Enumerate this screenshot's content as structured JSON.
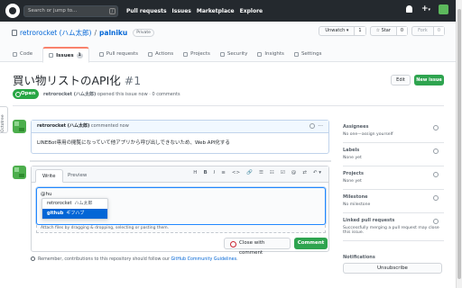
{
  "topbar": {
    "search_placeholder": "Search or jump to...",
    "slash_key": "/",
    "nav": [
      "Pull requests",
      "Issues",
      "Marketplace",
      "Explore"
    ],
    "plus": "+",
    "caret": "▾"
  },
  "repo": {
    "owner": "retrorocket (ハム太郎)",
    "separator": "/",
    "name": "palniku",
    "visibility": "Private",
    "watch_label": "Unwatch ▾",
    "watch_count": "1",
    "star_label": "☆ Star",
    "star_count": "0",
    "fork_label": "Fork",
    "fork_count": "0"
  },
  "tabs": [
    {
      "label": "Code"
    },
    {
      "label": "Issues",
      "count": "1"
    },
    {
      "label": "Pull requests"
    },
    {
      "label": "Actions"
    },
    {
      "label": "Projects"
    },
    {
      "label": "Security"
    },
    {
      "label": "Insights"
    },
    {
      "label": "Settings"
    }
  ],
  "sidetab": "Octotree",
  "issue": {
    "title": "買い物リストのAPI化",
    "number": "#1",
    "edit_label": "Edit",
    "new_issue_label": "New issue",
    "state": "Open",
    "author": "retrorocket (ハム太郎)",
    "opened_text": "opened this issue now · 0 comments"
  },
  "comment": {
    "author": "retrorocket (ハム太郎)",
    "time": "commented now",
    "more": "···",
    "body": "LINEBot専用の閲覧になっていて他アプリから呼び出しできないため、Web API化する"
  },
  "editor": {
    "write_tab": "Write",
    "preview_tab": "Preview",
    "toolbar": [
      "H",
      "B",
      "I",
      "≡",
      "<>",
      "🔗",
      "☰",
      "☷",
      "☑",
      "@",
      "⇄",
      "↶ ▾"
    ],
    "text": "@hu",
    "attach_hint": "Attach files by dragging & dropping, selecting or pasting them.",
    "suggestions": [
      {
        "login": "retrorocket",
        "name": "ハム太郎",
        "highlighted": false
      },
      {
        "login": "github",
        "name": "ギフハブ",
        "highlighted": true
      }
    ],
    "close_label": "Close with comment",
    "comment_label": "Comment"
  },
  "guide": {
    "text": "Remember, contributions to this repository should follow our",
    "link": "GitHub Community Guidelines",
    "end": "."
  },
  "sidebar": {
    "sections": [
      {
        "title": "Assignees",
        "value": "No one—assign yourself"
      },
      {
        "title": "Labels",
        "value": "None yet"
      },
      {
        "title": "Projects",
        "value": "None yet"
      },
      {
        "title": "Milestone",
        "value": "No milestone"
      },
      {
        "title": "Linked pull requests",
        "value": "Successfully merging a pull request may close this issue."
      }
    ],
    "notifications_title": "Notifications",
    "subscribe_label": "Unsubscribe"
  },
  "colors": {
    "header_bg": "#24292e",
    "accent": "#0366d6",
    "open_green": "#28a745",
    "button_green": "#2ea44f"
  }
}
